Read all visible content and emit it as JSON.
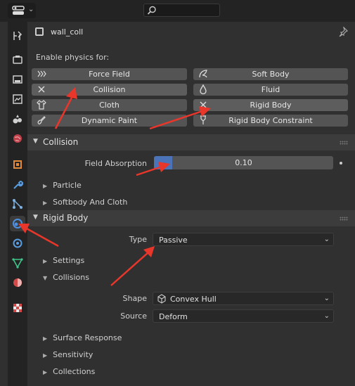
{
  "header": {
    "search_placeholder": ""
  },
  "object": {
    "name": "wall_coll"
  },
  "physics": {
    "enable_label": "Enable physics for:",
    "buttons": [
      {
        "label": "Force Field",
        "icon": "force-field-icon"
      },
      {
        "label": "Soft Body",
        "icon": "soft-body-icon"
      },
      {
        "label": "Collision",
        "icon": "close-icon"
      },
      {
        "label": "Fluid",
        "icon": "fluid-icon"
      },
      {
        "label": "Cloth",
        "icon": "cloth-icon"
      },
      {
        "label": "Rigid Body",
        "icon": "close-icon"
      },
      {
        "label": "Dynamic Paint",
        "icon": "dynamic-paint-icon"
      },
      {
        "label": "Rigid Body Constraint",
        "icon": "constraint-icon"
      }
    ]
  },
  "collision": {
    "title": "Collision",
    "field_absorption_label": "Field Absorption",
    "field_absorption_value": "0.10",
    "field_absorption_fraction": 0.1,
    "subpanels": [
      "Particle",
      "Softbody And Cloth"
    ]
  },
  "rigid_body": {
    "title": "Rigid Body",
    "type_label": "Type",
    "type_value": "Passive",
    "settings_label": "Settings",
    "collisions_label": "Collisions",
    "shape_label": "Shape",
    "shape_value": "Convex Hull",
    "source_label": "Source",
    "source_value": "Deform",
    "subpanels": [
      "Surface Response",
      "Sensitivity",
      "Collections"
    ]
  },
  "colors": {
    "accent": "#4a73b8",
    "annotation": "#e8362b"
  }
}
